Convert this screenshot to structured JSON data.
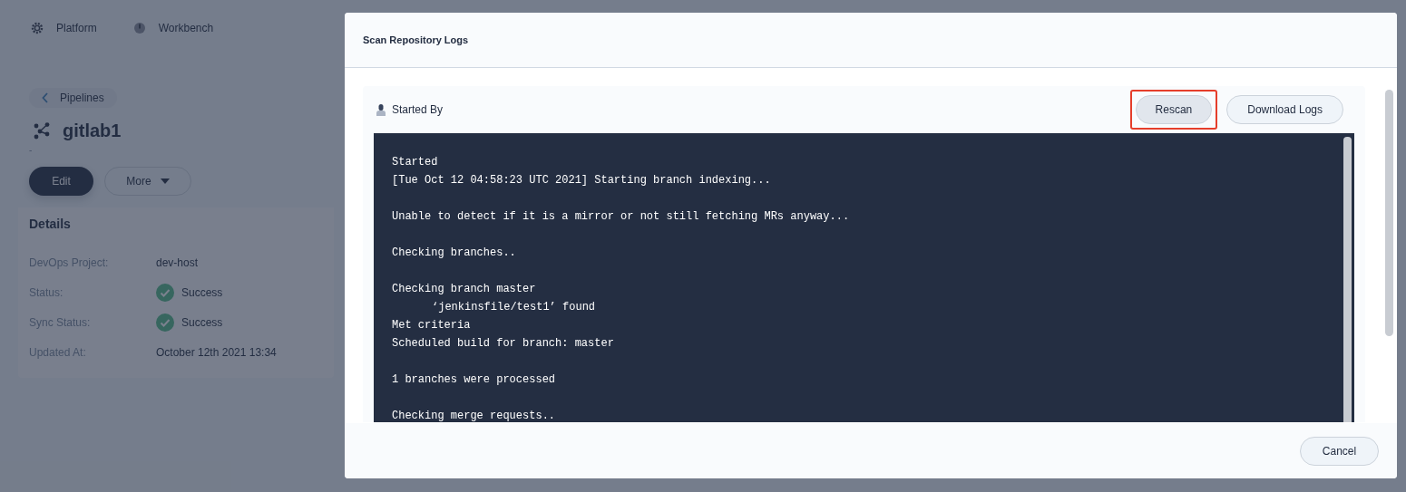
{
  "top_nav": [
    {
      "label": "Platform"
    },
    {
      "label": "Workbench"
    }
  ],
  "pipeline": {
    "back_link": "Pipelines",
    "name": "gitlab1",
    "description": "-",
    "buttons": [
      {
        "label": "Edit",
        "kind": "primary"
      },
      {
        "label": "More",
        "kind": "dropdown"
      }
    ]
  },
  "details": {
    "title": "Details",
    "rows": [
      {
        "label": "DevOps Project:",
        "value": "dev-host",
        "kind": "text"
      },
      {
        "label": "Status:",
        "value": "Success",
        "kind": "status"
      },
      {
        "label": "Sync Status:",
        "value": "Success",
        "kind": "status"
      },
      {
        "label": "Updated At:",
        "value": "October 12th 2021 13:34",
        "kind": "text"
      }
    ]
  },
  "modal": {
    "title": "Scan Repository Logs",
    "started_by": "Started By",
    "actions": [
      {
        "label": "Rescan",
        "highlighted": true
      },
      {
        "label": "Download Logs",
        "highlighted": false
      }
    ],
    "log_lines": [
      {
        "text": "Started",
        "gap_before": false,
        "indent": false
      },
      {
        "text": "[Tue Oct 12 04:58:23 UTC 2021] Starting branch indexing...",
        "gap_before": false,
        "indent": false
      },
      {
        "text": "Unable to detect if it is a mirror or not still fetching MRs anyway...",
        "gap_before": true,
        "indent": false
      },
      {
        "text": "Checking branches..",
        "gap_before": true,
        "indent": false
      },
      {
        "text": "Checking branch master",
        "gap_before": true,
        "indent": false
      },
      {
        "text": "‘jenkinsfile/test1’ found",
        "gap_before": false,
        "indent": true
      },
      {
        "text": "Met criteria",
        "gap_before": false,
        "indent": false
      },
      {
        "text": "Scheduled build for branch: master",
        "gap_before": false,
        "indent": false
      },
      {
        "text": "1 branches were processed",
        "gap_before": true,
        "indent": false
      },
      {
        "text": "Checking merge requests..",
        "gap_before": true,
        "indent": false
      }
    ],
    "footer_button": "Cancel"
  }
}
